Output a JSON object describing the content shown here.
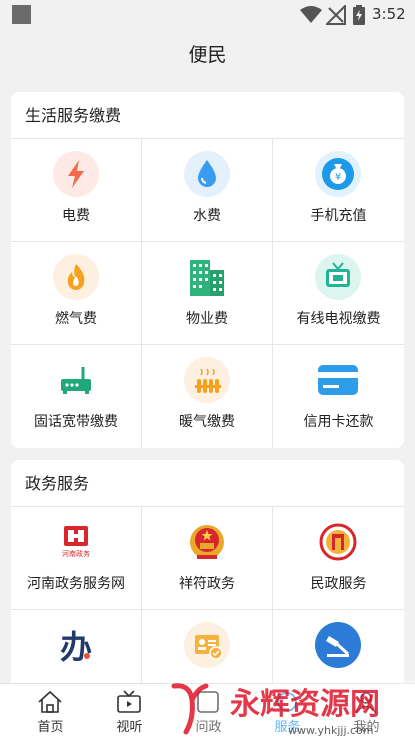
{
  "status_bar": {
    "time": "3:52"
  },
  "header": {
    "title": "便民"
  },
  "sections": [
    {
      "title": "生活服务缴费",
      "items": [
        {
          "label": "电费",
          "icon": "lightning-icon"
        },
        {
          "label": "水费",
          "icon": "water-drop-icon"
        },
        {
          "label": "手机充值",
          "icon": "money-bag-icon"
        },
        {
          "label": "燃气费",
          "icon": "flame-icon"
        },
        {
          "label": "物业费",
          "icon": "building-icon"
        },
        {
          "label": "有线电视缴费",
          "icon": "tv-icon"
        },
        {
          "label": "固话宽带缴费",
          "icon": "router-icon"
        },
        {
          "label": "暖气缴费",
          "icon": "radiator-icon"
        },
        {
          "label": "信用卡还款",
          "icon": "credit-card-icon"
        }
      ]
    },
    {
      "title": "政务服务",
      "items": [
        {
          "label": "河南政务服务网",
          "logo_text": "河南政务"
        },
        {
          "label": "祥符政务",
          "icon": "national-emblem-icon"
        },
        {
          "label": "民政服务",
          "icon": "civil-affairs-icon"
        },
        {
          "label": "",
          "logo_text": "办"
        },
        {
          "label": "",
          "icon": "id-card-icon"
        },
        {
          "label": "",
          "icon": "shield-hammer-icon"
        }
      ]
    }
  ],
  "tabs": [
    {
      "label": "首页",
      "icon": "home-icon"
    },
    {
      "label": "视听",
      "icon": "tv-play-icon"
    },
    {
      "label": "问政",
      "icon": "question-icon"
    },
    {
      "label": "服务",
      "icon": "service-icon"
    },
    {
      "label": "我的",
      "icon": "user-icon"
    }
  ],
  "watermark": {
    "text": "永辉资源网",
    "url": "www.yhkjjj.com"
  },
  "colors": {
    "accent": "#2196f3",
    "watermark_red": "#e0152b"
  }
}
